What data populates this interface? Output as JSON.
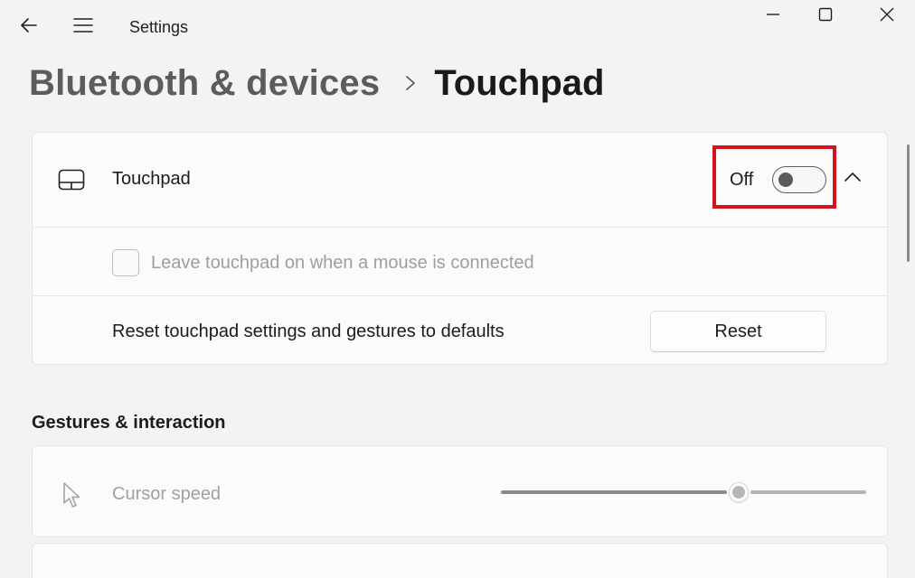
{
  "window": {
    "title": "Settings"
  },
  "breadcrumb": {
    "parent": "Bluetooth & devices",
    "current": "Touchpad"
  },
  "touchpad_card": {
    "label": "Touchpad",
    "toggle_state": "Off",
    "toggle_on": false,
    "leave_on_label": "Leave touchpad on when a mouse is connected",
    "leave_on_checked": false,
    "reset_label": "Reset touchpad settings and gestures to defaults",
    "reset_button": "Reset"
  },
  "gestures_section": {
    "title": "Gestures & interaction",
    "cursor_speed_label": "Cursor speed",
    "cursor_speed_fraction": 0.65
  },
  "colors": {
    "highlight": "#d6141e",
    "background": "#f3f3f3",
    "card": "#fbfbfb"
  },
  "icons": {
    "back": "back-arrow-icon",
    "menu": "hamburger-menu-icon",
    "minimize": "minimize-icon",
    "maximize": "maximize-icon",
    "close": "close-icon",
    "breadcrumb_separator": "chevron-right-icon",
    "touchpad": "touchpad-icon",
    "collapse": "chevron-up-icon",
    "cursor": "mouse-pointer-icon"
  }
}
